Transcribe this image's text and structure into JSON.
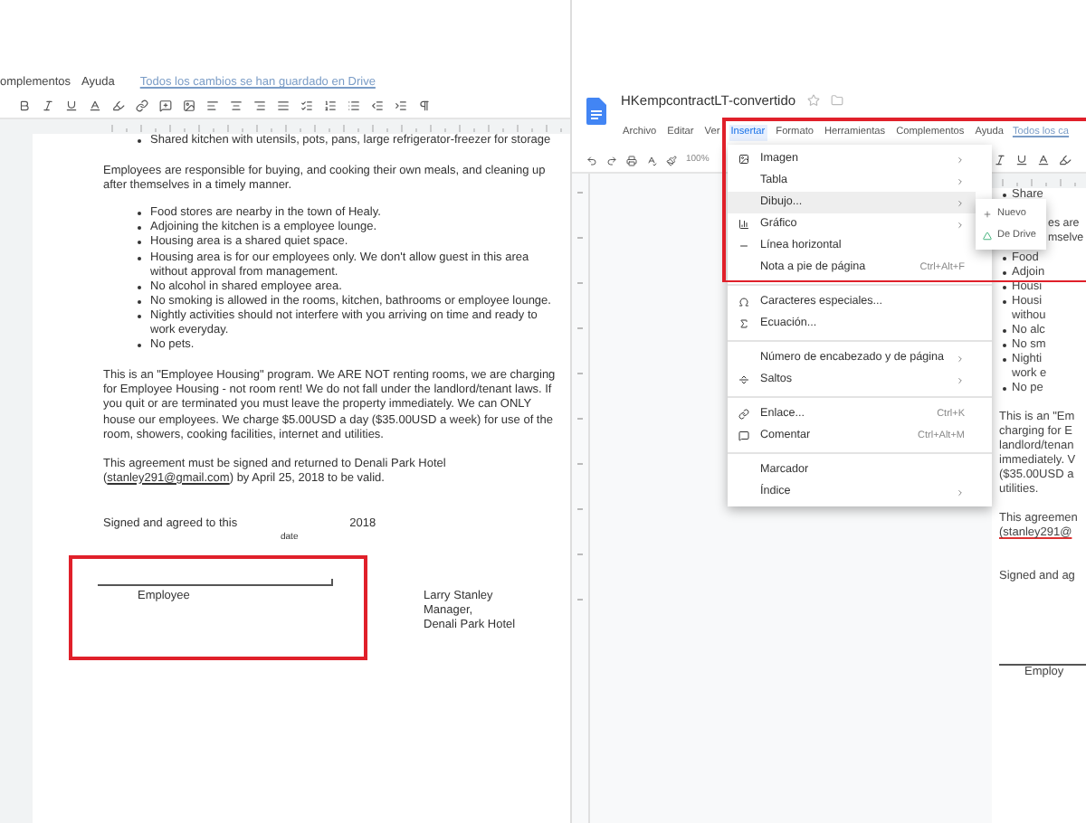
{
  "left_doc": {
    "menu": [
      "omplementos",
      "Ayuda"
    ],
    "save_status": "Todos los cambios se han guardado en Drive",
    "body": [
      {
        "kind": "bullets",
        "items": [
          "Shared kitchen with utensils, pots, pans, large refrigerator-freezer for storage"
        ]
      },
      {
        "kind": "paragraph",
        "text": "Employees are responsible for buying, and cooking their own meals, and cleaning up after themselves in a timely manner."
      },
      {
        "kind": "bullets",
        "items": [
          "Food stores are nearby in the town of Healy.",
          "Adjoining the kitchen is a employee lounge.",
          "Housing area is a shared quiet space.",
          "Housing area is for our employees only. We don't allow guest in this area without approval from management.",
          "No alcohol in shared employee area.",
          "No smoking is allowed in the rooms, kitchen, bathrooms or employee lounge.",
          "Nightly activities should not interfere with you arriving on time and ready to work everyday.",
          "No pets."
        ]
      },
      {
        "kind": "paragraph",
        "text": "This is an \"Employee Housing\" program. We ARE NOT renting rooms, we are charging for Employee Housing - not room rent! We do not fall under the landlord/tenant laws. If you quit or are terminated you must leave the property immediately. We can ONLY house our employees. We charge $5.00USD a day ($35.00USD a week) for use of the room, showers, cooking facilities, internet and utilities."
      },
      {
        "kind": "agreement",
        "before": "This agreement must be signed and returned to Denali Park Hotel (",
        "link": "stanley291@gmail.com",
        "after": ") by April 25, 2018 to be valid."
      }
    ],
    "signed": {
      "text": "Signed and agreed to this",
      "year": "2018",
      "date_label": "date"
    },
    "employee_label": "Employee",
    "signer": [
      "Larry Stanley",
      "Manager,",
      "Denali Park Hotel"
    ]
  },
  "right_doc": {
    "title": "HKempcontractLT-convertido",
    "menus": [
      {
        "label": "Archivo",
        "selected": false
      },
      {
        "label": "Editar",
        "selected": false
      },
      {
        "label": "Ver",
        "selected": false
      },
      {
        "label": "Insertar",
        "selected": true
      },
      {
        "label": "Formato",
        "selected": false
      },
      {
        "label": "Herramientas",
        "selected": false
      },
      {
        "label": "Complementos",
        "selected": false
      },
      {
        "label": "Ayuda",
        "selected": false
      }
    ],
    "save_status": "Todos los ca",
    "zoom": "100%",
    "lines": [
      {
        "kind": "bullet",
        "text": "Share"
      },
      {
        "kind": "gap"
      },
      {
        "kind": "covered",
        "text": "es are"
      },
      {
        "kind": "covered",
        "text": "mselve"
      },
      {
        "kind": "gap"
      },
      {
        "kind": "bullet",
        "text": "Food"
      },
      {
        "kind": "bullet",
        "text": "Adjoin"
      },
      {
        "kind": "bullet",
        "text": "Housi"
      },
      {
        "kind": "bullet",
        "text": "Housi"
      },
      {
        "kind": "cont",
        "text": "withou"
      },
      {
        "kind": "bullet",
        "text": "No alc"
      },
      {
        "kind": "bullet",
        "text": "No sm"
      },
      {
        "kind": "bullet",
        "text": "Nighti"
      },
      {
        "kind": "cont",
        "text": "work e"
      },
      {
        "kind": "bullet",
        "text": "No pe"
      },
      {
        "kind": "gap"
      },
      {
        "kind": "text",
        "text": "This is an \"Em"
      },
      {
        "kind": "text",
        "text": "charging for E"
      },
      {
        "kind": "text",
        "text": "landlord/tenan"
      },
      {
        "kind": "text",
        "text": "immediately. V"
      },
      {
        "kind": "text",
        "text": "($35.00USD a"
      },
      {
        "kind": "text",
        "text": "utilities."
      },
      {
        "kind": "gap"
      },
      {
        "kind": "text",
        "text": "This agreemen"
      },
      {
        "kind": "link",
        "text": "(stanley291@"
      },
      {
        "kind": "gap"
      },
      {
        "kind": "gap"
      },
      {
        "kind": "text",
        "text": "Signed and ag"
      }
    ],
    "employee_label": "Employ",
    "insert_menu": [
      [
        {
          "label": "Imagen",
          "submenu": true,
          "selected": false
        },
        {
          "label": "Tabla",
          "submenu": true,
          "selected": false
        },
        {
          "label": "Dibujo...",
          "submenu": true,
          "selected": true
        },
        {
          "label": "Gráfico",
          "submenu": true,
          "selected": false
        },
        {
          "label": "Línea horizontal",
          "submenu": false,
          "selected": false
        },
        {
          "label": "Nota a pie de página",
          "shortcut": "Ctrl+Alt+F",
          "submenu": false,
          "selected": false
        }
      ],
      [
        {
          "label": "Caracteres especiales...",
          "submenu": false,
          "selected": false
        },
        {
          "label": "Ecuación...",
          "submenu": false,
          "selected": false
        }
      ],
      [
        {
          "label": "Número de encabezado y de página",
          "submenu": true,
          "selected": false
        },
        {
          "label": "Saltos",
          "submenu": true,
          "selected": false
        }
      ],
      [
        {
          "label": "Enlace...",
          "shortcut": "Ctrl+K",
          "submenu": false,
          "selected": false
        },
        {
          "label": "Comentar",
          "shortcut": "Ctrl+Alt+M",
          "submenu": false,
          "selected": false
        }
      ],
      [
        {
          "label": "Marcador",
          "submenu": false,
          "selected": false
        },
        {
          "label": "Índice",
          "submenu": true,
          "selected": false
        }
      ]
    ],
    "drawing_submenu": [
      "Nuevo",
      "De Drive"
    ]
  }
}
